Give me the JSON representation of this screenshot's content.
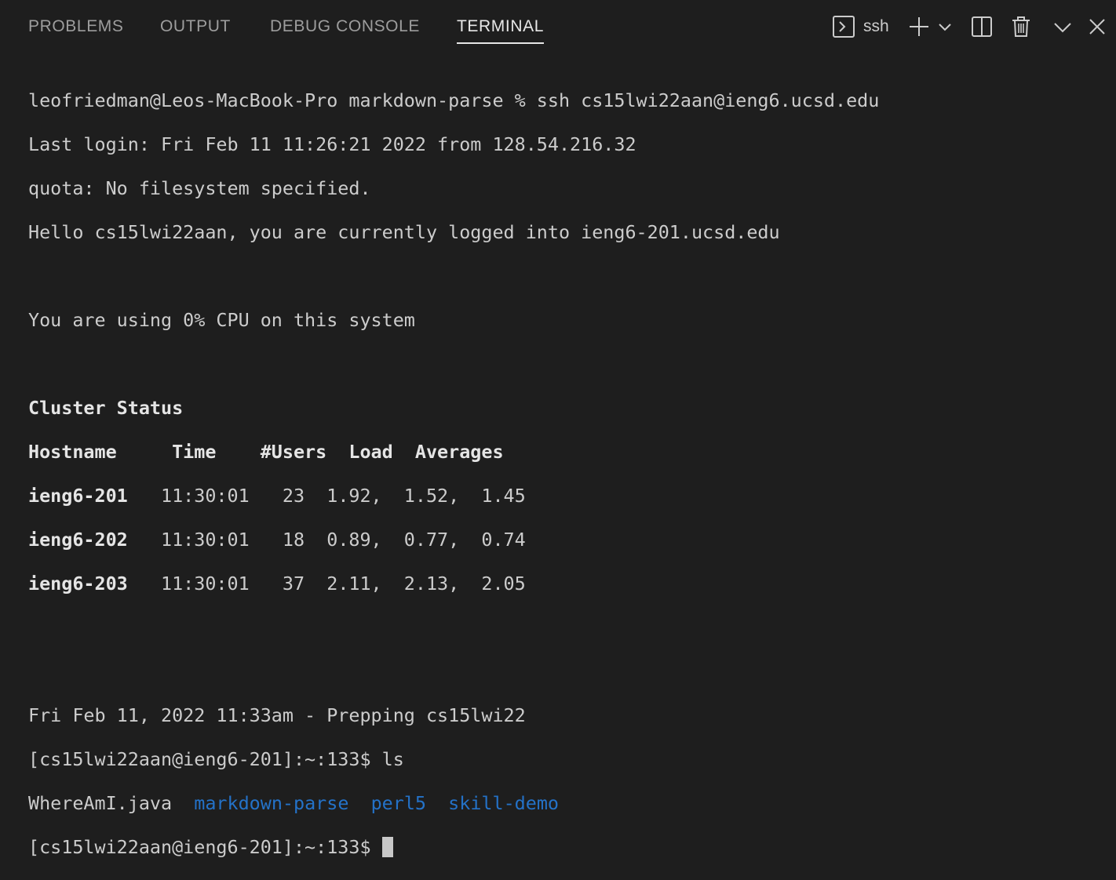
{
  "tabs": [
    {
      "label": "PROBLEMS"
    },
    {
      "label": "OUTPUT"
    },
    {
      "label": "DEBUG CONSOLE"
    },
    {
      "label": "TERMINAL",
      "active": true
    }
  ],
  "toolbar": {
    "terminal_name": "ssh",
    "icons": [
      "terminal-icon",
      "plus-icon",
      "chevron-down-icon",
      "split-icon",
      "trash-icon",
      "chevron-down-icon",
      "close-icon"
    ]
  },
  "terminal": {
    "login_cmd": "leofriedman@Leos-MacBook-Pro markdown-parse % ssh cs15lwi22aan@ieng6.ucsd.edu",
    "last_login": "Last login: Fri Feb 11 11:26:21 2022 from 128.54.216.32",
    "quota": "quota: No filesystem specified.",
    "hello": "Hello cs15lwi22aan, you are currently logged into ieng6-201.ucsd.edu",
    "cpu": "You are using 0% CPU on this system",
    "cluster_title": "Cluster Status",
    "cluster_header": "Hostname     Time    #Users  Load  Averages",
    "cluster_rows": [
      {
        "host": "ieng6-201",
        "rest": "   11:30:01   23  1.92,  1.52,  1.45"
      },
      {
        "host": "ieng6-202",
        "rest": "   11:30:01   18  0.89,  0.77,  0.74"
      },
      {
        "host": "ieng6-203",
        "rest": "   11:30:01   37  2.11,  2.13,  2.05"
      }
    ],
    "prepping": "Fri Feb 11, 2022 11:33am - Prepping cs15lwi22",
    "prompt_ls": "[cs15lwi22aan@ieng6-201]:~:133$ ls",
    "ls_output": {
      "file": "WhereAmI.java",
      "dirs": [
        "markdown-parse",
        "perl5",
        "skill-demo"
      ]
    },
    "prompt_final": "[cs15lwi22aan@ieng6-201]:~:133$ "
  },
  "colors": {
    "background": "#1e1e1e",
    "text": "#cccccc",
    "directory": "#2472c8",
    "tab_active": "#e7e7e7",
    "tab_inactive": "#9d9d9d"
  }
}
